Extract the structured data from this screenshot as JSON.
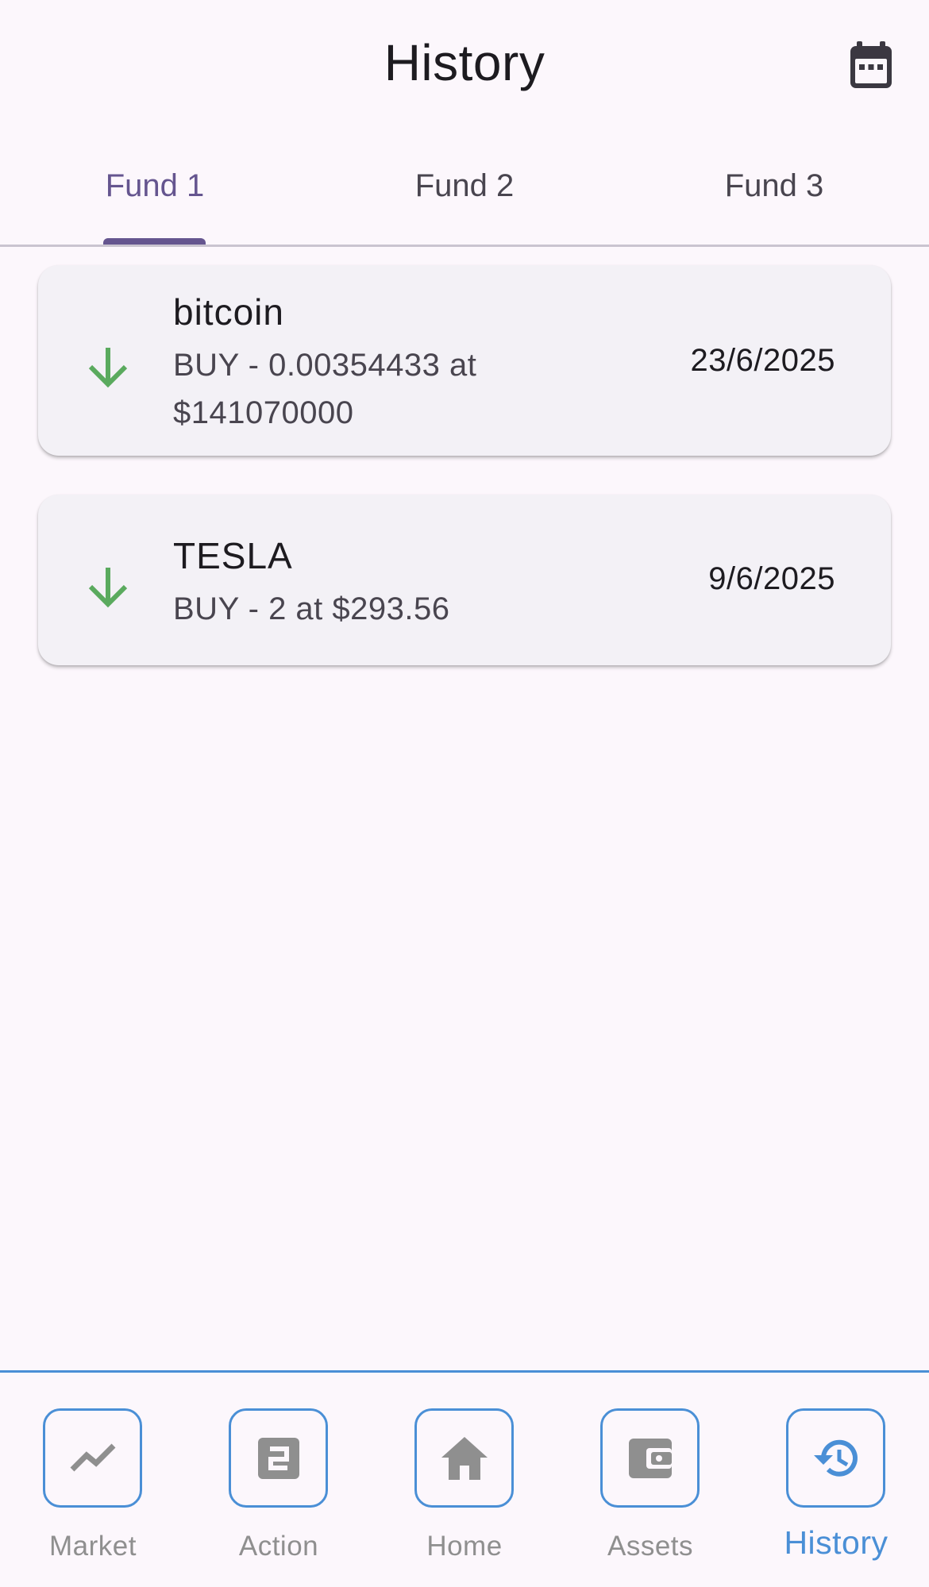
{
  "header": {
    "title": "History",
    "calendar_icon": "calendar-icon"
  },
  "tabs": [
    {
      "label": "Fund 1",
      "active": true
    },
    {
      "label": "Fund 2",
      "active": false
    },
    {
      "label": "Fund 3",
      "active": false
    }
  ],
  "transactions": [
    {
      "asset": "bitcoin",
      "detail_line1": "BUY - 0.00354433 at",
      "detail_line2": "$141070000",
      "date": "23/6/2025",
      "icon": "arrow-down-icon",
      "icon_color": "#5aaa5e"
    },
    {
      "asset": "TESLA",
      "detail_line1": "BUY - 2 at $293.56",
      "date": "9/6/2025",
      "icon": "arrow-down-icon",
      "icon_color": "#5aaa5e"
    }
  ],
  "bottom_nav": [
    {
      "label": "Market",
      "icon": "trending-icon",
      "active": false
    },
    {
      "label": "Action",
      "icon": "action-icon",
      "active": false
    },
    {
      "label": "Home",
      "icon": "home-icon",
      "active": false
    },
    {
      "label": "Assets",
      "icon": "wallet-icon",
      "active": false
    },
    {
      "label": "History",
      "icon": "history-icon",
      "active": true
    }
  ],
  "colors": {
    "accent": "#65558f",
    "nav_accent": "#4a8fd6",
    "buy_green": "#5aaa5e",
    "inactive_icon": "#8f8f8f"
  }
}
